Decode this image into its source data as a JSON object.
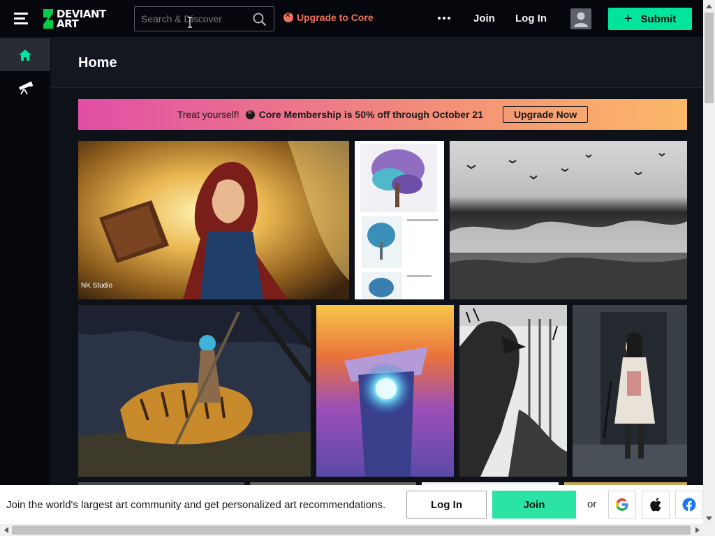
{
  "header": {
    "logo_line1": "DEVIANT",
    "logo_line2": "ART",
    "search_placeholder": "Search & Discover",
    "upgrade_label": "Upgrade to Core",
    "join_label": "Join",
    "login_label": "Log In",
    "submit_label": "Submit"
  },
  "sidebar": {
    "items": [
      {
        "name": "home",
        "icon": "home-icon",
        "active": true
      },
      {
        "name": "discover",
        "icon": "telescope-icon",
        "active": false
      }
    ]
  },
  "main": {
    "title": "Home",
    "promo": {
      "lead": "Treat yourself!",
      "offer": "Core Membership is 50% off through October 21",
      "cta": "Upgrade Now"
    },
    "watermark": "NK Studio"
  },
  "join_banner": {
    "text": "Join the world's largest art community and get personalized art recommendations.",
    "login_label": "Log In",
    "join_label": "Join",
    "or_label": "or"
  },
  "colors": {
    "brand_green": "#00e59b",
    "upgrade_orange": "#f0735b",
    "promo_start": "#e14fa6",
    "promo_end": "#fbb867"
  }
}
